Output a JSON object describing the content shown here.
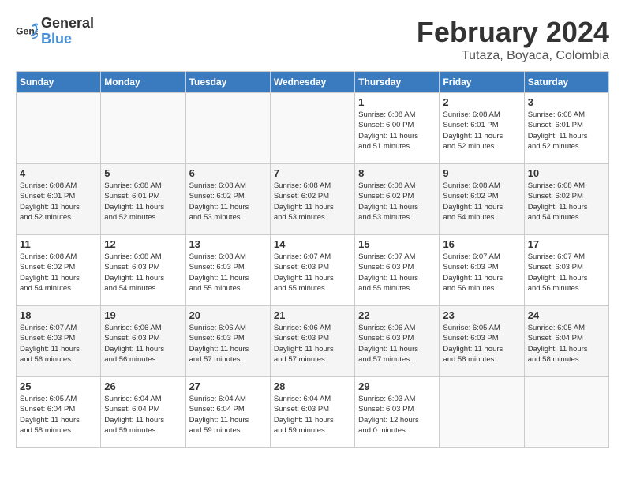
{
  "header": {
    "logo_line1": "General",
    "logo_line2": "Blue",
    "title": "February 2024",
    "subtitle": "Tutaza, Boyaca, Colombia"
  },
  "weekdays": [
    "Sunday",
    "Monday",
    "Tuesday",
    "Wednesday",
    "Thursday",
    "Friday",
    "Saturday"
  ],
  "weeks": [
    [
      {
        "day": "",
        "info": ""
      },
      {
        "day": "",
        "info": ""
      },
      {
        "day": "",
        "info": ""
      },
      {
        "day": "",
        "info": ""
      },
      {
        "day": "1",
        "info": "Sunrise: 6:08 AM\nSunset: 6:00 PM\nDaylight: 11 hours\nand 51 minutes."
      },
      {
        "day": "2",
        "info": "Sunrise: 6:08 AM\nSunset: 6:01 PM\nDaylight: 11 hours\nand 52 minutes."
      },
      {
        "day": "3",
        "info": "Sunrise: 6:08 AM\nSunset: 6:01 PM\nDaylight: 11 hours\nand 52 minutes."
      }
    ],
    [
      {
        "day": "4",
        "info": "Sunrise: 6:08 AM\nSunset: 6:01 PM\nDaylight: 11 hours\nand 52 minutes."
      },
      {
        "day": "5",
        "info": "Sunrise: 6:08 AM\nSunset: 6:01 PM\nDaylight: 11 hours\nand 52 minutes."
      },
      {
        "day": "6",
        "info": "Sunrise: 6:08 AM\nSunset: 6:02 PM\nDaylight: 11 hours\nand 53 minutes."
      },
      {
        "day": "7",
        "info": "Sunrise: 6:08 AM\nSunset: 6:02 PM\nDaylight: 11 hours\nand 53 minutes."
      },
      {
        "day": "8",
        "info": "Sunrise: 6:08 AM\nSunset: 6:02 PM\nDaylight: 11 hours\nand 53 minutes."
      },
      {
        "day": "9",
        "info": "Sunrise: 6:08 AM\nSunset: 6:02 PM\nDaylight: 11 hours\nand 54 minutes."
      },
      {
        "day": "10",
        "info": "Sunrise: 6:08 AM\nSunset: 6:02 PM\nDaylight: 11 hours\nand 54 minutes."
      }
    ],
    [
      {
        "day": "11",
        "info": "Sunrise: 6:08 AM\nSunset: 6:02 PM\nDaylight: 11 hours\nand 54 minutes."
      },
      {
        "day": "12",
        "info": "Sunrise: 6:08 AM\nSunset: 6:03 PM\nDaylight: 11 hours\nand 54 minutes."
      },
      {
        "day": "13",
        "info": "Sunrise: 6:08 AM\nSunset: 6:03 PM\nDaylight: 11 hours\nand 55 minutes."
      },
      {
        "day": "14",
        "info": "Sunrise: 6:07 AM\nSunset: 6:03 PM\nDaylight: 11 hours\nand 55 minutes."
      },
      {
        "day": "15",
        "info": "Sunrise: 6:07 AM\nSunset: 6:03 PM\nDaylight: 11 hours\nand 55 minutes."
      },
      {
        "day": "16",
        "info": "Sunrise: 6:07 AM\nSunset: 6:03 PM\nDaylight: 11 hours\nand 56 minutes."
      },
      {
        "day": "17",
        "info": "Sunrise: 6:07 AM\nSunset: 6:03 PM\nDaylight: 11 hours\nand 56 minutes."
      }
    ],
    [
      {
        "day": "18",
        "info": "Sunrise: 6:07 AM\nSunset: 6:03 PM\nDaylight: 11 hours\nand 56 minutes."
      },
      {
        "day": "19",
        "info": "Sunrise: 6:06 AM\nSunset: 6:03 PM\nDaylight: 11 hours\nand 56 minutes."
      },
      {
        "day": "20",
        "info": "Sunrise: 6:06 AM\nSunset: 6:03 PM\nDaylight: 11 hours\nand 57 minutes."
      },
      {
        "day": "21",
        "info": "Sunrise: 6:06 AM\nSunset: 6:03 PM\nDaylight: 11 hours\nand 57 minutes."
      },
      {
        "day": "22",
        "info": "Sunrise: 6:06 AM\nSunset: 6:03 PM\nDaylight: 11 hours\nand 57 minutes."
      },
      {
        "day": "23",
        "info": "Sunrise: 6:05 AM\nSunset: 6:03 PM\nDaylight: 11 hours\nand 58 minutes."
      },
      {
        "day": "24",
        "info": "Sunrise: 6:05 AM\nSunset: 6:04 PM\nDaylight: 11 hours\nand 58 minutes."
      }
    ],
    [
      {
        "day": "25",
        "info": "Sunrise: 6:05 AM\nSunset: 6:04 PM\nDaylight: 11 hours\nand 58 minutes."
      },
      {
        "day": "26",
        "info": "Sunrise: 6:04 AM\nSunset: 6:04 PM\nDaylight: 11 hours\nand 59 minutes."
      },
      {
        "day": "27",
        "info": "Sunrise: 6:04 AM\nSunset: 6:04 PM\nDaylight: 11 hours\nand 59 minutes."
      },
      {
        "day": "28",
        "info": "Sunrise: 6:04 AM\nSunset: 6:03 PM\nDaylight: 11 hours\nand 59 minutes."
      },
      {
        "day": "29",
        "info": "Sunrise: 6:03 AM\nSunset: 6:03 PM\nDaylight: 12 hours\nand 0 minutes."
      },
      {
        "day": "",
        "info": ""
      },
      {
        "day": "",
        "info": ""
      }
    ]
  ]
}
